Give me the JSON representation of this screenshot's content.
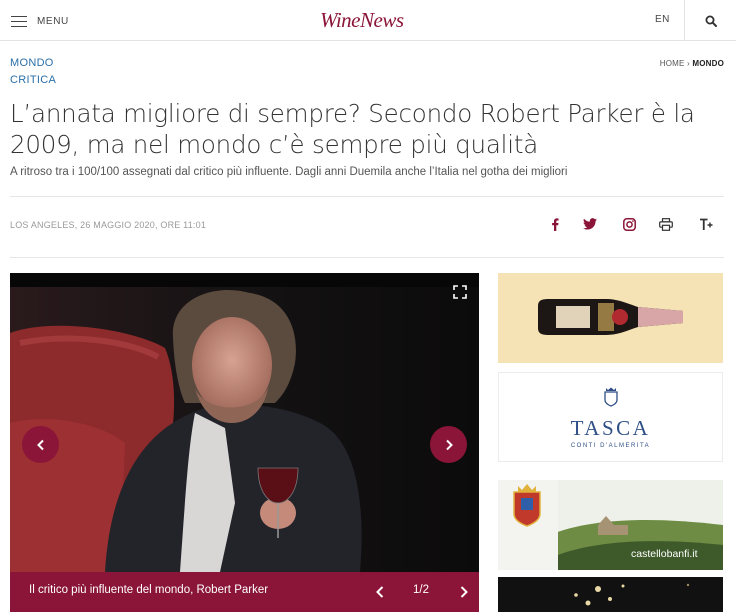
{
  "header": {
    "menu_label": "MENU",
    "logo_text": "WineNews",
    "lang": "EN",
    "icons": {
      "menu": "hamburger-icon",
      "search": "search-icon"
    },
    "brand_color": "#8b1538"
  },
  "article": {
    "section": "MONDO",
    "category": "CRITICA",
    "breadcrumb": {
      "home": "HOME",
      "separator": "›",
      "current": "MONDO"
    },
    "title": "L’annata migliore di sempre? Secondo Robert Parker è la 2009, ma nel mondo c’è sempre più qualità",
    "subtitle": "A ritroso tra i 100/100 assegnati dal critico più influente. Dagli anni Duemila anche l’Italia nel gotha dei migliori",
    "meta": "LOS ANGELES, 26 MAGGIO 2020, ORE 11:01",
    "share_icons": [
      "facebook-icon",
      "twitter-icon",
      "instagram-icon",
      "print-icon",
      "text-size-icon"
    ]
  },
  "gallery": {
    "caption": "Il critico più influente del mondo, Robert Parker",
    "counter": "1/2",
    "icons": [
      "expand-icon",
      "chevron-left-icon",
      "chevron-right-icon"
    ]
  },
  "sidebar": {
    "ads": [
      {
        "name": "champagne-ad"
      },
      {
        "name": "tasca-ad",
        "brand": "TASCA",
        "tagline": "CONTI D'ALMERITA"
      },
      {
        "name": "castello-banfi-ad",
        "url": "castellobanfi.it"
      },
      {
        "name": "sparkling-ad"
      }
    ]
  }
}
